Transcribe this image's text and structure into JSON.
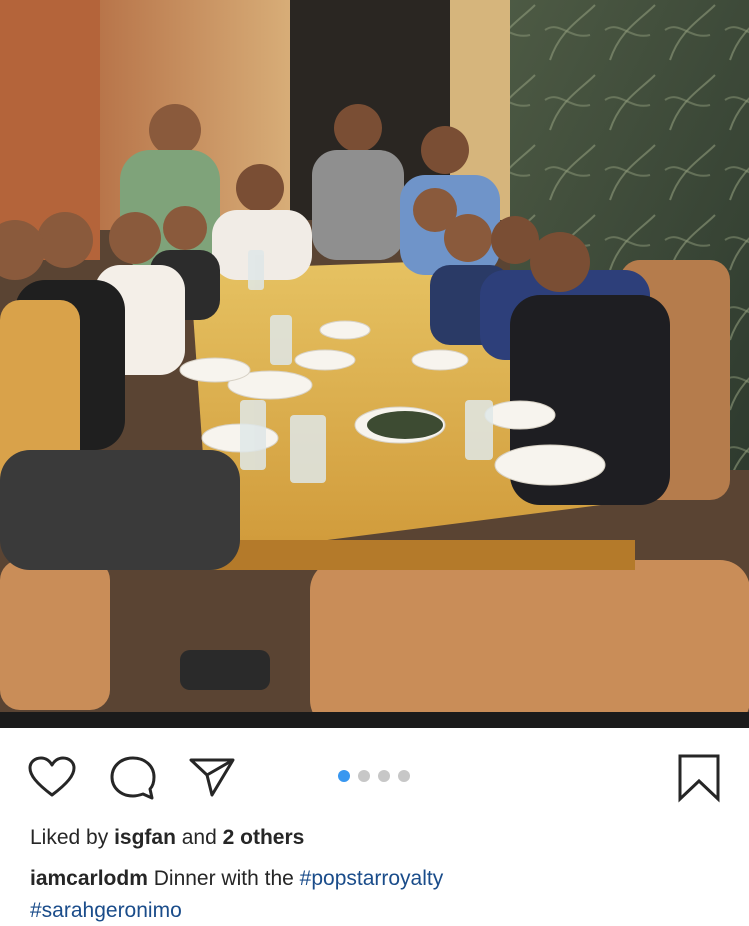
{
  "post": {
    "image_alt": "Group dinner photo",
    "likes": {
      "prefix": "Liked by",
      "user": "isgfan",
      "middle": "and",
      "others": "2 others"
    },
    "caption": {
      "username": "iamcarlodm",
      "text": "Dinner with the",
      "hashtag1": "#popstarroyalty",
      "hashtag2": "#sarahgeronimo"
    },
    "carousel": {
      "count": 4,
      "active_index": 0,
      "active_color": "#3897f0",
      "inactive_color": "#c7c7c7"
    }
  },
  "actions": {
    "like_icon": "heart-icon",
    "comment_icon": "comment-icon",
    "share_icon": "paper-plane-icon",
    "save_icon": "bookmark-icon"
  },
  "colors": {
    "hashtag": "#1a4c8a",
    "text": "#262626"
  }
}
